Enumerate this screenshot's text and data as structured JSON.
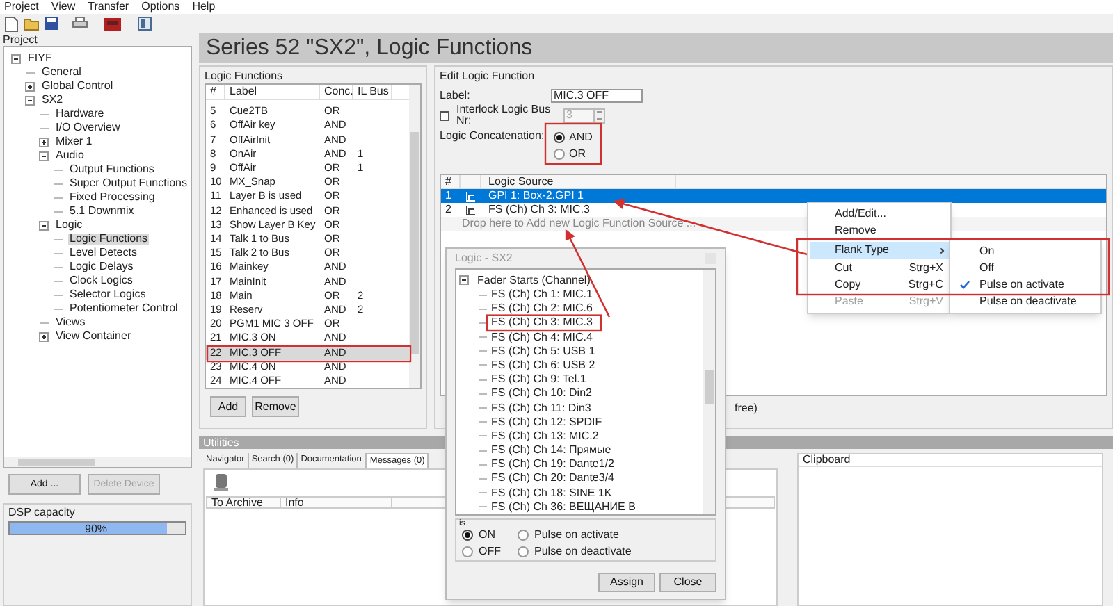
{
  "menu": [
    "Project",
    "View",
    "Transfer",
    "Options",
    "Help"
  ],
  "project_panel": {
    "title": "Project",
    "tree": [
      {
        "label": "FIYF",
        "expanded": true,
        "selected": false,
        "children": [
          {
            "label": "General",
            "selected": false
          },
          {
            "label": "Global Control",
            "expanded": false,
            "selected": false
          },
          {
            "label": "SX2",
            "expanded": true,
            "selected": false,
            "children": [
              {
                "label": "Hardware",
                "selected": false
              },
              {
                "label": "I/O Overview",
                "selected": false
              },
              {
                "label": "Mixer 1",
                "expanded": false,
                "selected": false
              },
              {
                "label": "Audio",
                "expanded": true,
                "selected": false,
                "children": [
                  {
                    "label": "Output Functions",
                    "selected": false
                  },
                  {
                    "label": "Super Output Functions",
                    "selected": false
                  },
                  {
                    "label": "Fixed Processing",
                    "selected": false
                  },
                  {
                    "label": "5.1 Downmix",
                    "selected": false
                  }
                ]
              },
              {
                "label": "Logic",
                "expanded": true,
                "selected": false,
                "children": [
                  {
                    "label": "Logic Functions",
                    "selected": true
                  },
                  {
                    "label": "Level Detects",
                    "selected": false
                  },
                  {
                    "label": "Logic Delays",
                    "selected": false
                  },
                  {
                    "label": "Clock Logics",
                    "selected": false
                  },
                  {
                    "label": "Selector Logics",
                    "selected": false
                  },
                  {
                    "label": "Potentiometer Control",
                    "selected": false
                  }
                ]
              },
              {
                "label": "Views",
                "selected": false
              },
              {
                "label": "View Container",
                "expanded": false,
                "selected": false
              }
            ]
          }
        ]
      }
    ],
    "buttons": [
      {
        "label": "Add ...",
        "disabled": false
      },
      {
        "label": "Delete Device",
        "disabled": true
      }
    ],
    "dsp": {
      "title": "DSP capacity",
      "level": 0.9,
      "reading": "90%"
    }
  },
  "header": {
    "title": "Series 52 \"SX2\", Logic Functions"
  },
  "logic_functions": {
    "title": "Logic Functions",
    "columns": [
      "#",
      "Label",
      "Conc.",
      "IL Bus"
    ],
    "rows": [
      {
        "cells": [
          "5",
          "Cue2TB",
          "OR",
          ""
        ],
        "selected": false
      },
      {
        "cells": [
          "6",
          "OffAir key",
          "AND",
          ""
        ],
        "selected": false
      },
      {
        "cells": [
          "7",
          "OffAirInit",
          "AND",
          ""
        ],
        "selected": false
      },
      {
        "cells": [
          "8",
          "OnAir",
          "AND",
          "1"
        ],
        "selected": false
      },
      {
        "cells": [
          "9",
          "OffAir",
          "OR",
          "1"
        ],
        "selected": false
      },
      {
        "cells": [
          "10",
          "MX_Snap",
          "OR",
          ""
        ],
        "selected": false
      },
      {
        "cells": [
          "11",
          "Layer B is used",
          "OR",
          ""
        ],
        "selected": false
      },
      {
        "cells": [
          "12",
          "Enhanced is used",
          "OR",
          ""
        ],
        "selected": false
      },
      {
        "cells": [
          "13",
          "Show Layer B Key",
          "OR",
          ""
        ],
        "selected": false
      },
      {
        "cells": [
          "14",
          "Talk 1 to Bus",
          "OR",
          ""
        ],
        "selected": false
      },
      {
        "cells": [
          "15",
          "Talk 2 to Bus",
          "OR",
          ""
        ],
        "selected": false
      },
      {
        "cells": [
          "16",
          "Mainkey",
          "AND",
          ""
        ],
        "selected": false
      },
      {
        "cells": [
          "17",
          "MainInit",
          "AND",
          ""
        ],
        "selected": false
      },
      {
        "cells": [
          "18",
          "Main",
          "OR",
          "2"
        ],
        "selected": false
      },
      {
        "cells": [
          "19",
          "Reserv",
          "AND",
          "2"
        ],
        "selected": false
      },
      {
        "cells": [
          "20",
          "PGM1 MIC 3 OFF",
          "OR",
          ""
        ],
        "selected": false
      },
      {
        "cells": [
          "21",
          "MIC.3 ON",
          "AND",
          ""
        ],
        "selected": false
      },
      {
        "cells": [
          "22",
          "MIC.3 OFF",
          "AND",
          ""
        ],
        "selected": true
      },
      {
        "cells": [
          "23",
          "MIC.4 ON",
          "AND",
          ""
        ],
        "selected": false
      },
      {
        "cells": [
          "24",
          "MIC.4 OFF",
          "AND",
          ""
        ],
        "selected": false
      }
    ],
    "buttons": [
      "Add",
      "Remove"
    ]
  },
  "edit": {
    "title": "Edit Logic Function",
    "label_caption": "Label:",
    "label_value": "MIC.3 OFF",
    "interlock": {
      "label": "Interlock Logic Bus Nr:",
      "checked": false,
      "value": "3"
    },
    "concatenation": {
      "label": "Logic Concatenation:",
      "options": [
        {
          "label": "AND",
          "selected": true
        },
        {
          "label": "OR",
          "selected": false
        }
      ]
    },
    "sources": {
      "columns": {
        "number": "#",
        "source": "Logic Source"
      },
      "rows": [
        {
          "number": "1",
          "source": "GPI 1: Box-2.GPI 1",
          "selected": true
        },
        {
          "number": "2",
          "source": "FS (Ch) Ch 3: MIC.3",
          "selected": false
        }
      ],
      "drop_hint": "Drop here to Add new Logic Function Source ...",
      "note": "free)"
    }
  },
  "utilities": {
    "title": "Utilities",
    "tabs": [
      {
        "label": "Navigator",
        "selected": false
      },
      {
        "label": "Search (0)",
        "selected": false
      },
      {
        "label": "Documentation",
        "selected": false
      },
      {
        "label": "Messages (0)",
        "selected": true
      }
    ],
    "columns": [
      "To Archive",
      "Info"
    ],
    "clipboard": "Clipboard"
  },
  "dialog": {
    "title": "Logic - SX2",
    "tree": {
      "label": "Fader Starts (Channel)",
      "expanded": true,
      "children": [
        "FS (Ch) Ch 1: MIC.1",
        "FS (Ch) Ch 2: MIC.6",
        "FS (Ch) Ch 3: MIC.3",
        "FS (Ch) Ch 4: MIC.4",
        "FS (Ch) Ch 5: USB 1",
        "FS (Ch) Ch 6: USB 2",
        "FS (Ch) Ch 9: Tel.1",
        "FS (Ch) Ch 10: Din2",
        "FS (Ch) Ch 11: Din3",
        "FS (Ch) Ch 12: SPDIF",
        "FS (Ch) Ch 13: MIC.2",
        "FS (Ch) Ch 14: Прямые",
        "FS (Ch) Ch 19: Dante1/2",
        "FS (Ch) Ch 20: Dante3/4",
        "FS (Ch) Ch 18: SINE 1K",
        "FS (Ch) Ch 36: ВЕЩАНИЕ B"
      ]
    },
    "group_title": "is",
    "options": [
      {
        "label": "ON",
        "selected": true
      },
      {
        "label": "Pulse on activate",
        "selected": false
      },
      {
        "label": "OFF",
        "selected": false
      },
      {
        "label": "Pulse on deactivate",
        "selected": false
      }
    ],
    "buttons": [
      "Assign",
      "Close"
    ]
  },
  "context_menu": {
    "items": [
      {
        "label": "Add/Edit...",
        "selected": false,
        "disabled": false
      },
      {
        "label": "Remove",
        "selected": false,
        "disabled": false
      },
      {
        "label": "Flank Type",
        "selected": true,
        "disabled": false,
        "submenu": true
      },
      {
        "label": "Cut",
        "shortcut": "Strg+X",
        "selected": false,
        "disabled": false
      },
      {
        "label": "Copy",
        "shortcut": "Strg+C",
        "selected": false,
        "disabled": false
      },
      {
        "label": "Paste",
        "shortcut": "Strg+V",
        "selected": false,
        "disabled": true
      }
    ],
    "submenu": [
      {
        "label": "On",
        "checked": false
      },
      {
        "label": "Off",
        "checked": false
      },
      {
        "label": "Pulse on activate",
        "checked": true
      },
      {
        "label": "Pulse on deactivate",
        "checked": false
      }
    ]
  }
}
